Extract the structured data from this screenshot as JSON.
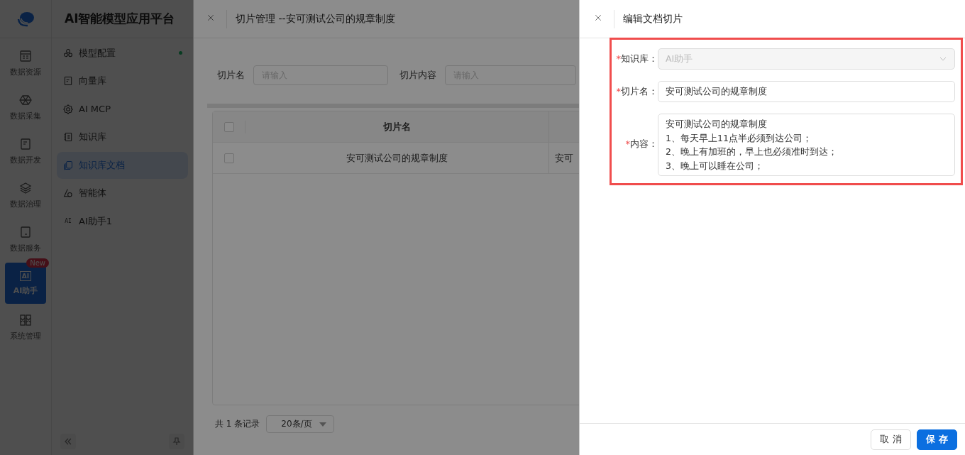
{
  "app": {
    "title": "AI智能模型应用平台"
  },
  "rail": [
    {
      "kind": "panel",
      "label": "数据资源",
      "selected": false
    },
    {
      "kind": "network",
      "label": "数据采集",
      "selected": false
    },
    {
      "kind": "document",
      "label": "数据开发",
      "selected": false
    },
    {
      "kind": "layers",
      "label": "数据治理",
      "selected": false
    },
    {
      "kind": "tablet",
      "label": "数据服务",
      "selected": false
    },
    {
      "kind": "ai",
      "icon_text": "AI",
      "label": "AI助手",
      "selected": true,
      "badge": "New"
    },
    {
      "kind": "grid",
      "label": "系统管理",
      "selected": false
    }
  ],
  "menu": [
    {
      "kind": "cluster",
      "label": "模型配置",
      "selected": false,
      "status_dot": true
    },
    {
      "kind": "document",
      "label": "向量库",
      "selected": false,
      "status_dot": false
    },
    {
      "kind": "gear",
      "label": "AI MCP",
      "selected": false,
      "status_dot": false
    },
    {
      "kind": "notebook",
      "label": "知识库",
      "selected": false,
      "status_dot": false
    },
    {
      "kind": "files",
      "label": "知识库文档",
      "selected": true,
      "status_dot": false
    },
    {
      "kind": "triangle",
      "label": "智能体",
      "selected": false,
      "status_dot": false
    },
    {
      "kind": "text",
      "icon_text": "AI",
      "label": "AI助手1",
      "selected": false,
      "status_dot": false
    }
  ],
  "slice_drawer": {
    "title": "切片管理 --安可测试公司的规章制度",
    "filters": [
      {
        "label": "切片名",
        "placeholder": "请输入"
      },
      {
        "label": "切片内容",
        "placeholder": "请输入"
      }
    ],
    "table": {
      "columns": [
        "切片名"
      ],
      "header_checked": false,
      "rows": [
        {
          "checked": false,
          "cells": [
            "安可测试公司的规章制度",
            "安可"
          ]
        }
      ]
    },
    "pagination": {
      "total": "共 1 条记录",
      "page_size": "20条/页"
    }
  },
  "edit_drawer": {
    "title": "编辑文档切片",
    "highlighted": true,
    "fields": [
      {
        "kind": "select",
        "required_mark": "*",
        "label": "知识库：",
        "disabled": true,
        "value": "AI助手"
      },
      {
        "kind": "input",
        "required_mark": "*",
        "label": "切片名：",
        "disabled": false,
        "value": "安可测试公司的规章制度"
      },
      {
        "kind": "textarea",
        "required_mark": "*",
        "label": "内容：",
        "disabled": false,
        "value": "安可测试公司的规章制度\n1、每天早上11点半必须到达公司；\n2、晚上有加班的，早上也必须准时到达；\n3、晚上可以睡在公司；"
      }
    ],
    "buttons": [
      {
        "kind": "default",
        "label": "取 消"
      },
      {
        "kind": "primary",
        "label": "保 存"
      }
    ]
  }
}
